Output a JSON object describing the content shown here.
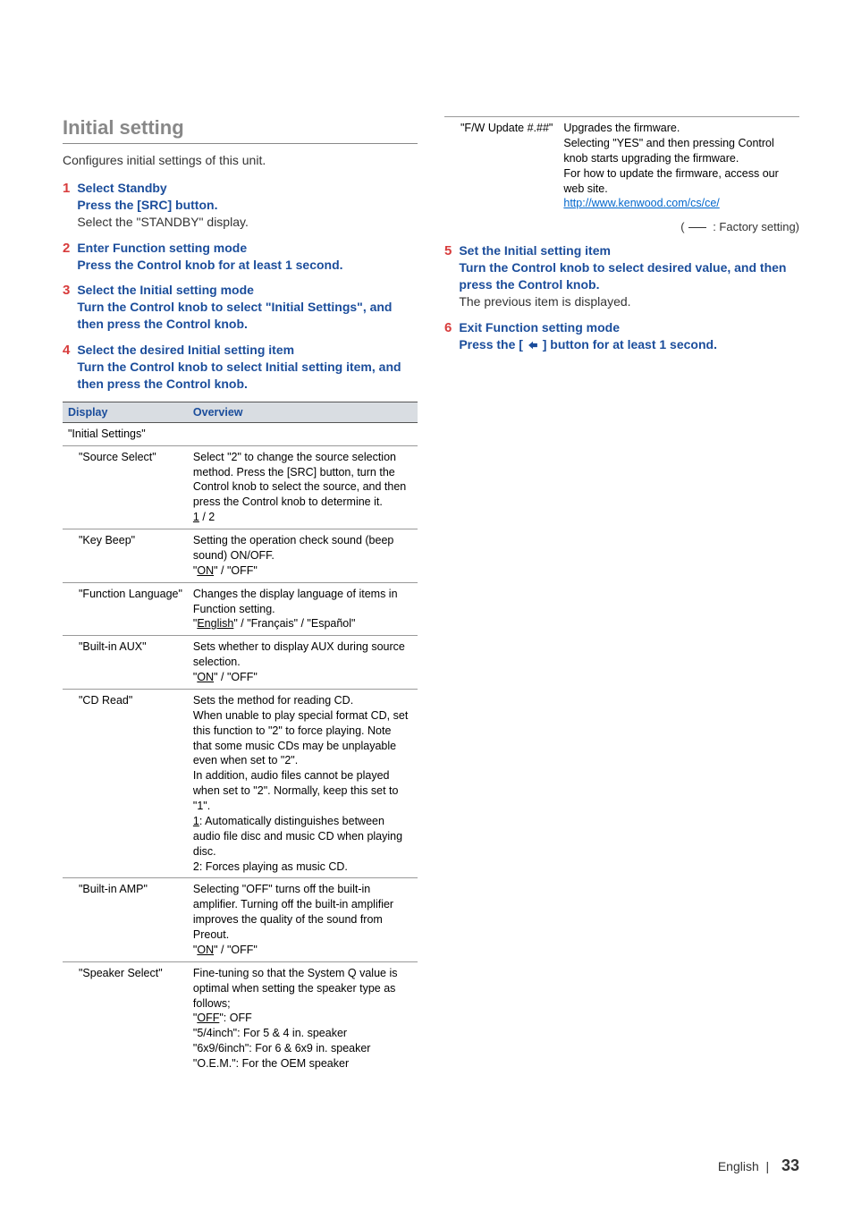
{
  "heading": "Initial setting",
  "intro": "Configures initial settings of this unit.",
  "steps_left": [
    {
      "num": "1",
      "title": "Select Standby",
      "sub": "Press the [SRC] button.",
      "plain": "Select the \"STANDBY\" display."
    },
    {
      "num": "2",
      "title": "Enter Function setting mode",
      "sub": "Press the Control knob for at least 1 second."
    },
    {
      "num": "3",
      "title": "Select the Initial setting mode",
      "sub": "Turn the Control knob to select \"Initial Settings\", and then press the Control knob."
    },
    {
      "num": "4",
      "title": "Select the desired Initial setting item",
      "sub": "Turn the Control knob to select Initial setting item, and then press the Control knob."
    }
  ],
  "table_headers": {
    "display": "Display",
    "overview": "Overview"
  },
  "table_rows": [
    {
      "name": "\"Initial Settings\"",
      "overview": "",
      "indent": false
    },
    {
      "name": "\"Source Select\"",
      "overview_html": "Select \"2\" to change the source selection method. Press the [SRC] button, turn the Control knob to select the source, and then press the Control knob to determine it.<br><span class=\"u\">1</span> / 2",
      "indent": true
    },
    {
      "name": "\"Key Beep\"",
      "overview_html": "Setting the operation check sound (beep sound) ON/OFF.<br>\"<span class=\"u\">ON</span>\" / \"OFF\"",
      "indent": true
    },
    {
      "name": "\"Function Language\"",
      "overview_html": "Changes the display language of items in Function setting.<br>\"<span class=\"u\">English</span>\" / \"Français\" / \"Español\"",
      "indent": true
    },
    {
      "name": "\"Built-in AUX\"",
      "overview_html": "Sets whether to display AUX during source selection.<br>\"<span class=\"u\">ON</span>\" / \"OFF\"",
      "indent": true
    },
    {
      "name": "\"CD Read\"",
      "overview_html": "Sets the method for reading CD.<br>When unable to play special format CD, set this function to \"2\" to force playing. Note that some music CDs may be unplayable even when set to \"2\".<br>In addition, audio files cannot be played when set to \"2\". Normally, keep this set to \"1\".<br><span class=\"u\">1</span>: Automatically distinguishes between audio file disc and music CD when playing disc.<br>2: Forces playing as music CD.",
      "indent": true
    },
    {
      "name": "\"Built-in AMP\"",
      "overview_html": "Selecting \"OFF\" turns off the built-in amplifier. Turning off the built-in amplifier improves the quality of the sound from Preout.<br>\"<span class=\"u\">ON</span>\" / \"OFF\"",
      "indent": true
    },
    {
      "name": "\"Speaker Select\"",
      "overview_html": "Fine-tuning so that the System Q value is optimal when setting the speaker type as follows;<br>\"<span class=\"u\">OFF</span>\": OFF<br>\"5/4inch\": For 5 &amp; 4 in. speaker<br>\"6x9/6inch\": For 6 &amp; 6x9 in. speaker<br>\"O.E.M.\": For the OEM speaker",
      "indent": true
    }
  ],
  "table_rows_right": [
    {
      "name": "\"F/W Update #.##\"",
      "overview_html": "Upgrades the firmware.<br>Selecting \"YES\" and then pressing Control knob starts upgrading the firmware.<br>For how to update the firmware, access our web site.<br><span class=\"link\">http://www.kenwood.com/cs/ce/</span>",
      "indent": true
    }
  ],
  "factory_note_prefix": "(",
  "factory_note_suffix": " : Factory setting)",
  "steps_right": [
    {
      "num": "5",
      "title": "Set the Initial setting item",
      "sub": "Turn the Control knob to select desired value, and then press the Control knob.",
      "plain": "The previous item is displayed."
    },
    {
      "num": "6",
      "title": "Exit Function setting mode",
      "sub_pre": "Press the [ ",
      "sub_post": " ] button for at least 1 second."
    }
  ],
  "footer": {
    "lang": "English",
    "sep": "|",
    "page": "33"
  }
}
